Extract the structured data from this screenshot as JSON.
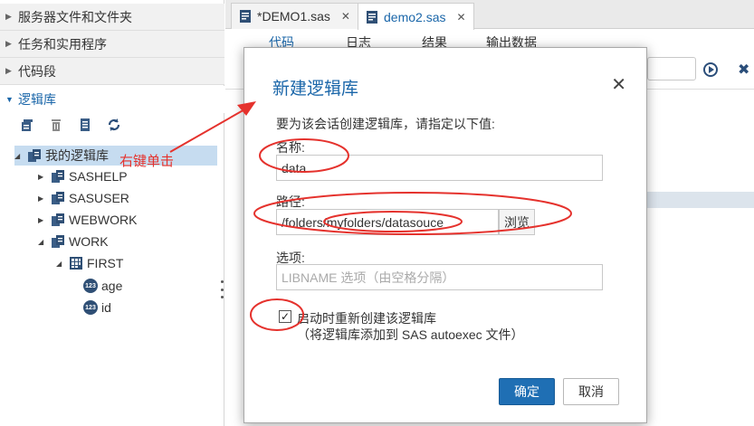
{
  "left_pane": {
    "sections": [
      {
        "label": "服务器文件和文件夹",
        "expanded": false
      },
      {
        "label": "任务和实用程序",
        "expanded": false
      },
      {
        "label": "代码段",
        "expanded": false
      },
      {
        "label": "逻辑库",
        "expanded": true
      }
    ],
    "toolbar_icons": [
      "new-library-icon",
      "delete-icon",
      "properties-icon",
      "refresh-icon"
    ],
    "tree": {
      "root": "我的逻辑库",
      "libraries": [
        "SASHELP",
        "SASUSER",
        "WEBWORK",
        "WORK"
      ],
      "work_table": "FIRST",
      "columns": [
        "age",
        "id"
      ],
      "column_badge": "123"
    },
    "annotation": "右键单击"
  },
  "editor": {
    "tabs": [
      {
        "label": "*DEMO1.sas",
        "active": false
      },
      {
        "label": "demo2.sas",
        "active": true
      }
    ],
    "close_glyph": "✕",
    "subtabs": [
      "代码",
      "日志",
      "结果",
      "输出数据"
    ]
  },
  "dialog": {
    "title": "新建逻辑库",
    "close_glyph": "✕",
    "intro": "要为该会话创建逻辑库，请指定以下值:",
    "name_label": "名称:",
    "name_value": "data",
    "path_label": "路径:",
    "path_value": "/folders/myfolders/datasouce",
    "browse_label": "浏览",
    "options_label": "选项:",
    "options_placeholder": "LIBNAME 选项（由空格分隔）",
    "checkbox_checked": true,
    "checkbox_glyph": "✓",
    "checkbox_label": "启动时重新创建该逻辑库",
    "checkbox_sublabel": "（将逻辑库添加到 SAS autoexec 文件）",
    "ok_label": "确定",
    "cancel_label": "取消"
  },
  "colors": {
    "accent": "#1a66a9",
    "annotation": "#e5322d",
    "selection": "#c6dcf0"
  }
}
